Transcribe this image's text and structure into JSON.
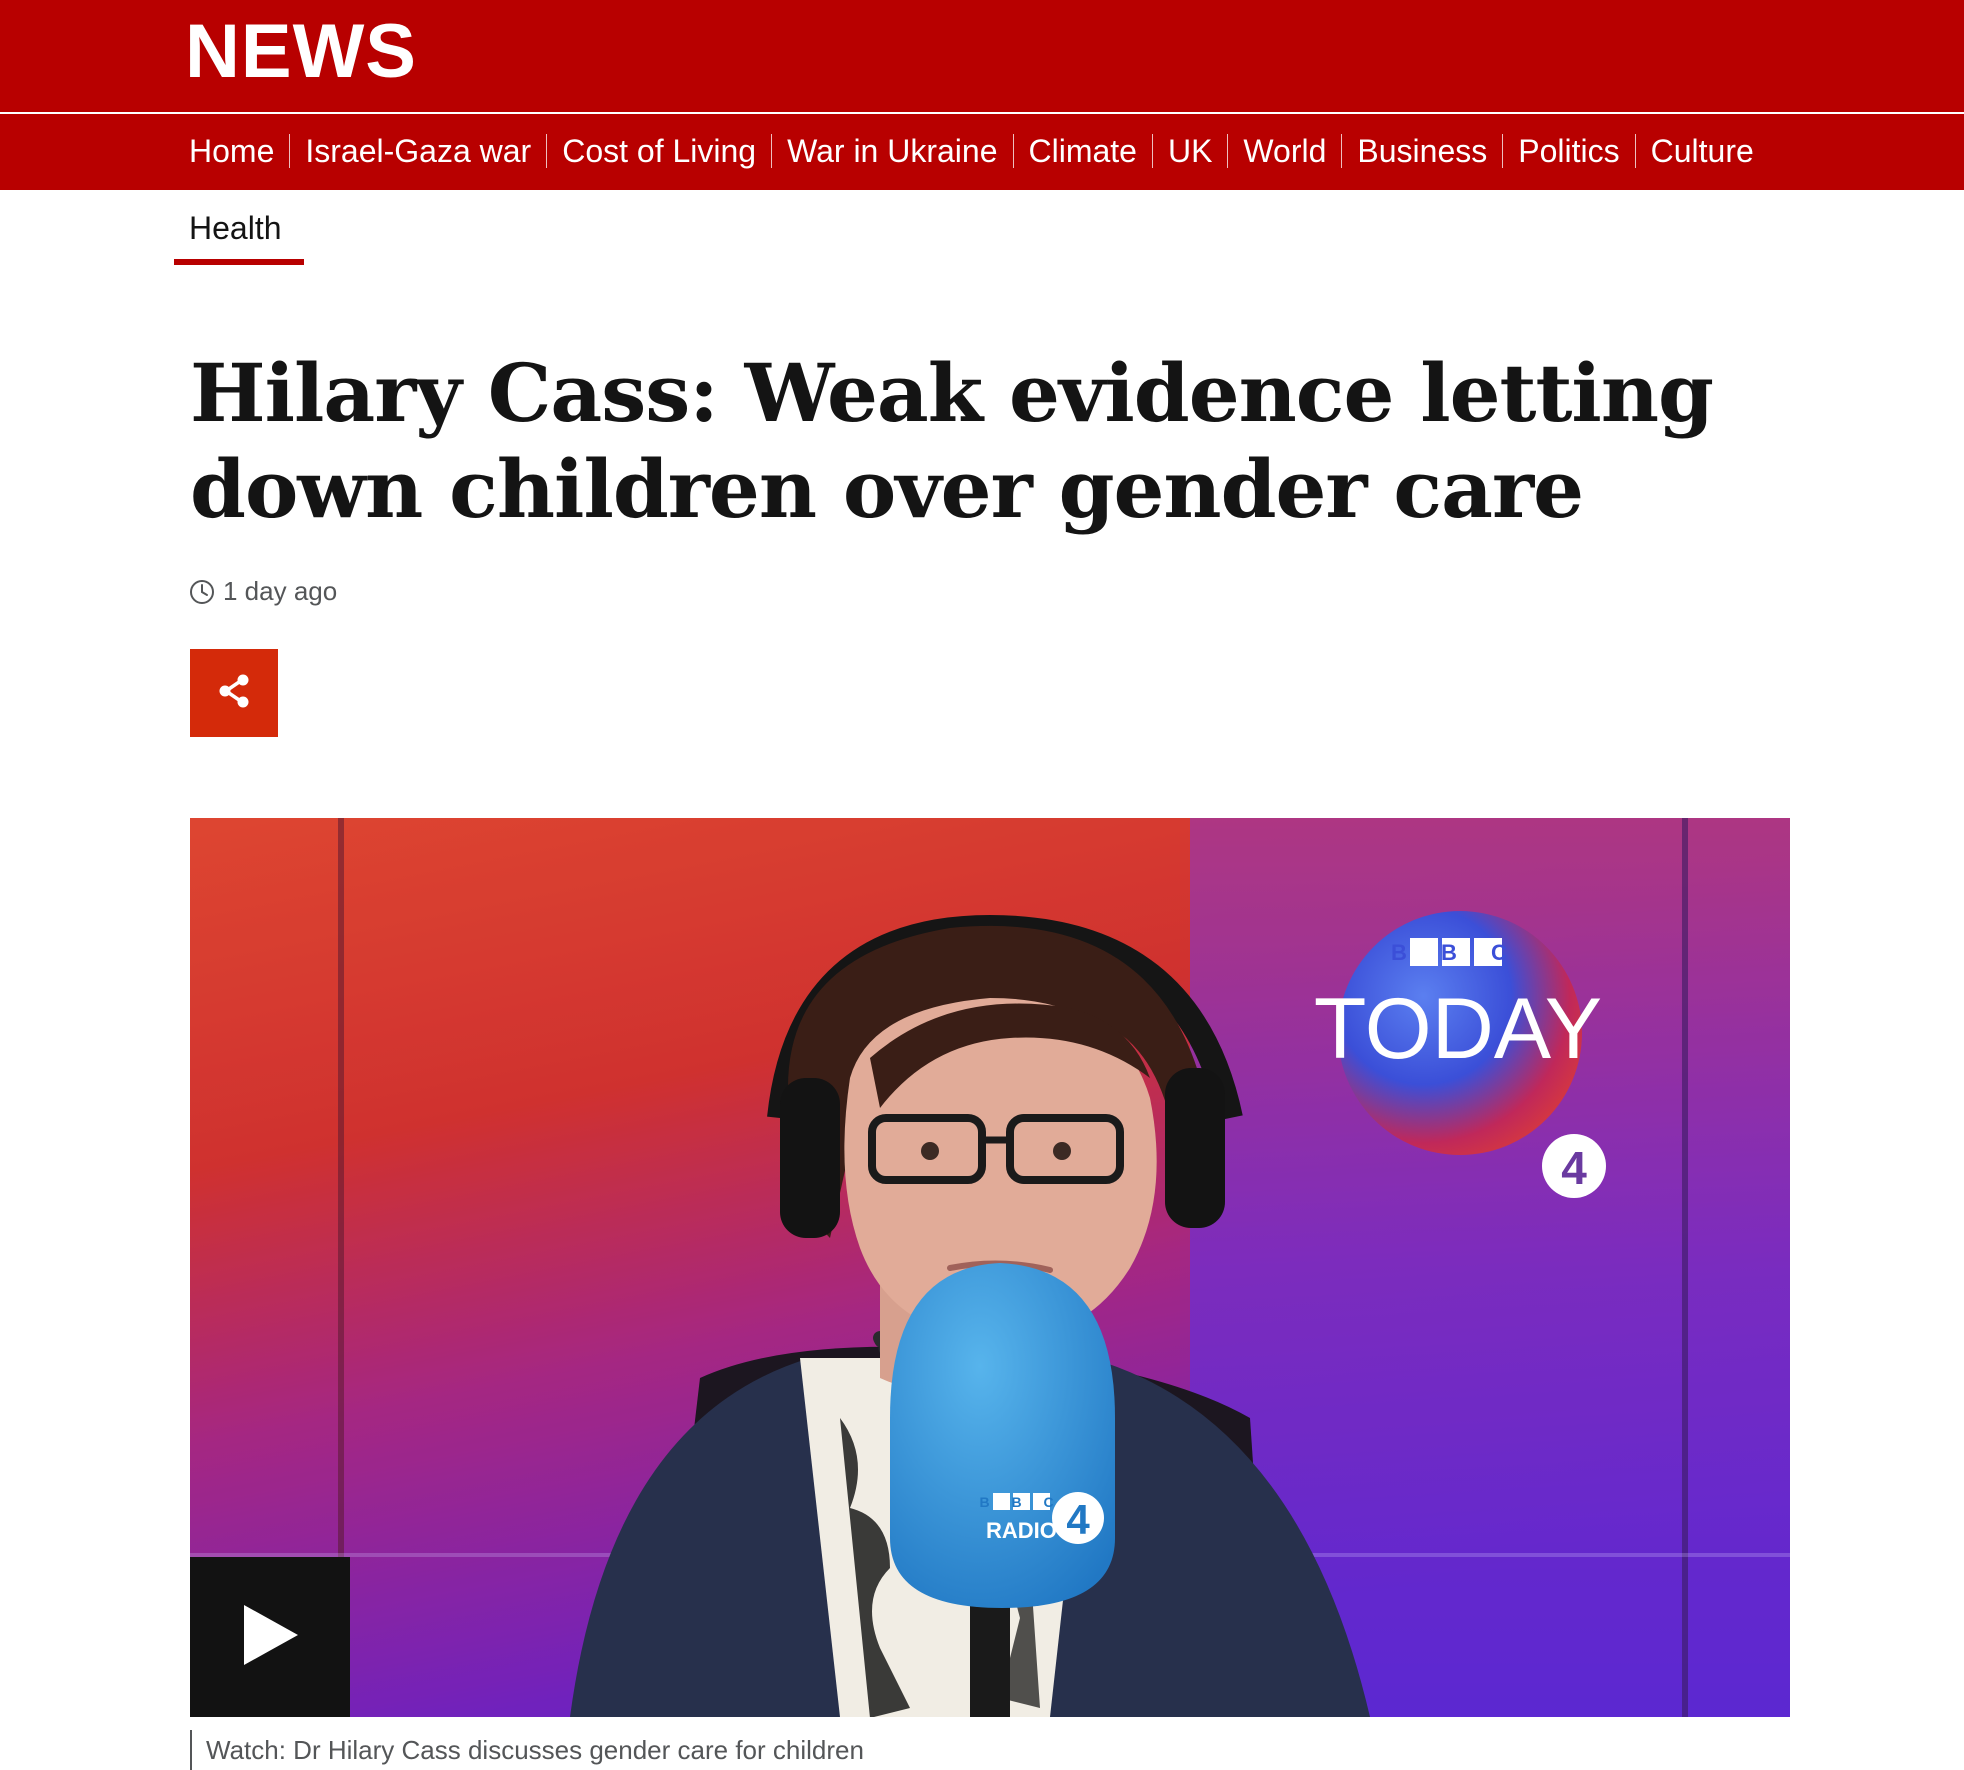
{
  "header": {
    "brand": "NEWS",
    "brand_color": "#b80000"
  },
  "nav": {
    "items": [
      {
        "label": "Home"
      },
      {
        "label": "Israel-Gaza war"
      },
      {
        "label": "Cost of Living"
      },
      {
        "label": "War in Ukraine"
      },
      {
        "label": "Climate"
      },
      {
        "label": "UK"
      },
      {
        "label": "World"
      },
      {
        "label": "Business"
      },
      {
        "label": "Politics"
      },
      {
        "label": "Culture"
      }
    ]
  },
  "subnav": {
    "active": "Health"
  },
  "article": {
    "headline_line1": "Hilary Cass: Weak evidence letting",
    "headline_line2": "down children over gender care",
    "timestamp": "1 day ago",
    "share_button_color": "#d42a0a"
  },
  "media": {
    "logo_small": "B B C",
    "logo_today": "TODAY",
    "logo_station": "4",
    "mic_bbc": "B B C",
    "mic_radio": "RADIO",
    "mic_station": "4",
    "caption": "Watch: Dr Hilary Cass discusses gender care for children"
  },
  "icons": {
    "clock": "clock-icon",
    "share": "share-icon",
    "play": "play-icon"
  }
}
